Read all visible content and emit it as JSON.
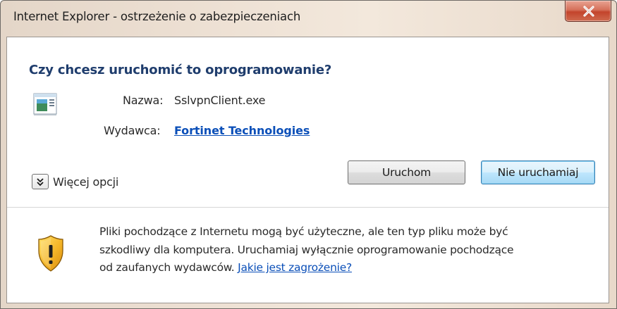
{
  "window": {
    "title": "Internet Explorer - ostrzeżenie o zabezpieczeniach"
  },
  "dialog": {
    "question": "Czy chcesz uruchomić to oprogramowanie?",
    "name_label": "Nazwa:",
    "name_value": "SslvpnClient.exe",
    "publisher_label": "Wydawca:",
    "publisher_value": "Fortinet Technologies",
    "more_options_label": "Więcej opcji",
    "run_button": "Uruchom",
    "dont_run_button": "Nie uruchamiaj"
  },
  "warning": {
    "line1": "Pliki pochodzące z Internetu mogą być użyteczne, ale ten typ pliku może być",
    "line2": "szkodliwy dla komputera. Uruchamiaj wyłącznie oprogramowanie pochodzące",
    "line3_prefix": "od zaufanych wydawców.",
    "risk_link": "Jakie jest zagrożenie?"
  },
  "icons": {
    "close": "close-icon",
    "file": "application-file-icon",
    "expand": "chevron-down-icon",
    "shield": "warning-shield-icon"
  },
  "colors": {
    "heading": "#1f3d6d",
    "link": "#0b4fb8",
    "close_button": "#c3442c",
    "default_button_border": "#3c7fb1"
  }
}
